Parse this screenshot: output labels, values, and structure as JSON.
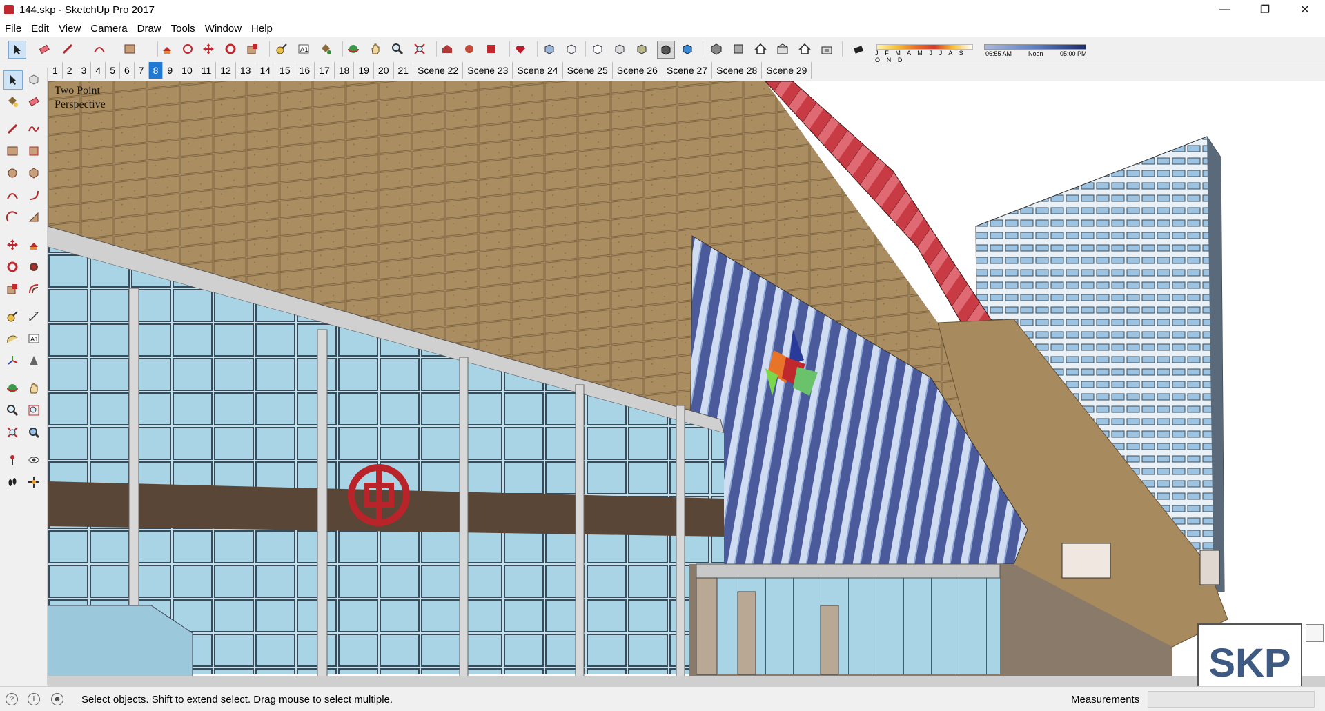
{
  "window": {
    "title": "144.skp - SketchUp Pro 2017"
  },
  "menu": [
    "File",
    "Edit",
    "View",
    "Camera",
    "Draw",
    "Tools",
    "Window",
    "Help"
  ],
  "shadow": {
    "months": "J F M A M J J A S O N D",
    "time_start": "06:55 AM",
    "time_mid": "Noon",
    "time_end": "05:00 PM"
  },
  "scenes": [
    "1",
    "2",
    "3",
    "4",
    "5",
    "6",
    "7",
    "8",
    "9",
    "10",
    "11",
    "12",
    "13",
    "14",
    "15",
    "16",
    "17",
    "18",
    "19",
    "20",
    "21",
    "Scene 22",
    "Scene 23",
    "Scene 24",
    "Scene 25",
    "Scene 26",
    "Scene 27",
    "Scene 28",
    "Scene 29"
  ],
  "active_scene": "8",
  "viewport": {
    "camera_label": "Two Point\nPerspective",
    "watermark": "SKP"
  },
  "status": {
    "message": "Select objects. Shift to extend select. Drag mouse to select multiple.",
    "measurements_label": "Measurements",
    "measurements_value": ""
  },
  "colors": {
    "accent": "#1e78d4",
    "facade": "#a88a5f",
    "glass": "#a8d4e6",
    "red_band": "#c83a44",
    "sky": "#ffffff"
  }
}
